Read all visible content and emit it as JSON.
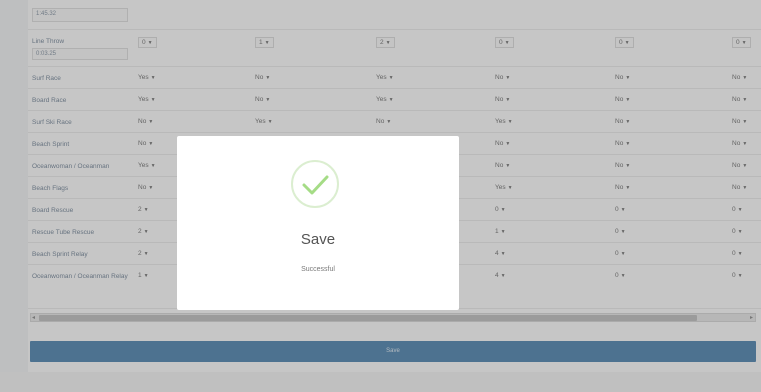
{
  "top_time": "1:45.32",
  "rows": [
    {
      "label": "Line Throw",
      "time": "0:03.25",
      "cells": [
        "0",
        "1",
        "2",
        "0",
        "0",
        "0"
      ]
    },
    {
      "label": "Surf Race",
      "cells": [
        "Yes",
        "No",
        "Yes",
        "No",
        "No",
        "No"
      ]
    },
    {
      "label": "Board Race",
      "cells": [
        "Yes",
        "No",
        "Yes",
        "No",
        "No",
        "No"
      ]
    },
    {
      "label": "Surf Ski Race",
      "cells": [
        "No",
        "Yes",
        "No",
        "Yes",
        "No",
        "No"
      ]
    },
    {
      "label": "Beach Sprint",
      "cells": [
        "No",
        "",
        "",
        "No",
        "No",
        "No"
      ]
    },
    {
      "label": "Oceanwoman / Oceanman",
      "cells": [
        "Yes",
        "",
        "",
        "No",
        "No",
        "No"
      ]
    },
    {
      "label": "Beach Flags",
      "cells": [
        "No",
        "",
        "",
        "Yes",
        "No",
        "No"
      ]
    },
    {
      "label": "Board Rescue",
      "cells": [
        "2",
        "",
        "",
        "0",
        "0",
        "0"
      ]
    },
    {
      "label": "Rescue Tube Rescue",
      "cells": [
        "2",
        "",
        "",
        "1",
        "0",
        "0"
      ]
    },
    {
      "label": "Beach Sprint Relay",
      "cells": [
        "2",
        "",
        "",
        "4",
        "0",
        "0"
      ]
    },
    {
      "label": "Oceanwoman / Oceanman Relay",
      "cells": [
        "1",
        "",
        "",
        "4",
        "0",
        "0"
      ]
    }
  ],
  "save_bar_label": "Save",
  "modal": {
    "title": "Save",
    "message": "Successful",
    "icon": "checkmark-icon",
    "accent_color": "#a5dc86"
  },
  "colors": {
    "save_bar": "#2f6fa3",
    "overlay": "rgba(120,120,120,0.42)"
  }
}
